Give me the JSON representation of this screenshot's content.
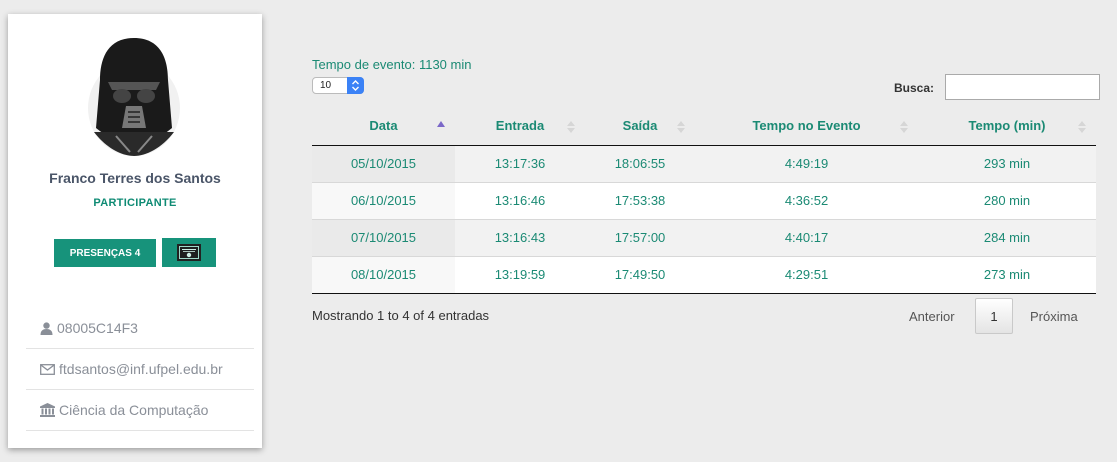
{
  "profile": {
    "name": "Franco Terres dos Santos",
    "role": "PARTICIPANTE",
    "presencas_button": "PRESENÇAS 4",
    "certificate_icon": "certificate-icon",
    "avatar_icon": "darth-vader-avatar",
    "info": [
      {
        "icon": "user-icon",
        "text": "08005C14F3"
      },
      {
        "icon": "envelope-icon",
        "text": "ftdsantos@inf.ufpel.edu.br"
      },
      {
        "icon": "institution-icon",
        "text": "Ciência da Computação"
      }
    ]
  },
  "main": {
    "event_time": "Tempo de evento: 1130 min",
    "page_length": "10",
    "search_label": "Busca:",
    "search_value": "",
    "columns": [
      "Data",
      "Entrada",
      "Saída",
      "Tempo no Evento",
      "Tempo (min)"
    ],
    "rows": [
      [
        "05/10/2015",
        "13:17:36",
        "18:06:55",
        "4:49:19",
        "293 min"
      ],
      [
        "06/10/2015",
        "13:16:46",
        "17:53:38",
        "4:36:52",
        "280 min"
      ],
      [
        "07/10/2015",
        "13:16:43",
        "17:57:00",
        "4:40:17",
        "284 min"
      ],
      [
        "08/10/2015",
        "13:19:59",
        "17:49:50",
        "4:29:51",
        "273 min"
      ]
    ],
    "info_text": "Mostrando 1 to 4 of 4 entradas",
    "pager": {
      "prev": "Anterior",
      "page": "1",
      "next": "Próxima"
    }
  },
  "colors": {
    "accent": "#17937b",
    "text_green": "#1b8a74",
    "background": "#ececec"
  }
}
